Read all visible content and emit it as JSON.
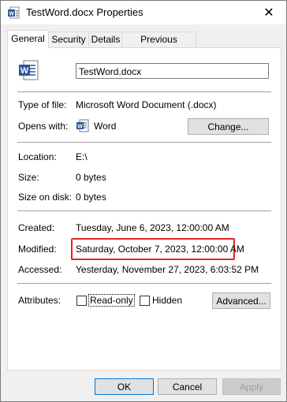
{
  "window": {
    "title": "TestWord.docx Properties",
    "close_symbol": "✕"
  },
  "tabs": [
    {
      "label": "General",
      "active": true
    },
    {
      "label": "Security",
      "active": false
    },
    {
      "label": "Details",
      "active": false
    },
    {
      "label": "Previous Versions",
      "active": false
    }
  ],
  "file": {
    "name": "TestWord.docx"
  },
  "info": {
    "type_label": "Type of file:",
    "type_value": "Microsoft Word Document (.docx)",
    "opens_label": "Opens with:",
    "opens_value": "Word",
    "change_button": "Change...",
    "location_label": "Location:",
    "location_value": "E:\\",
    "size_label": "Size:",
    "size_value": "0 bytes",
    "size_disk_label": "Size on disk:",
    "size_disk_value": "0 bytes",
    "created_label": "Created:",
    "created_value": "Tuesday, June 6, 2023, 12:00:00 AM",
    "modified_label": "Modified:",
    "modified_value": "Saturday, October 7, 2023, 12:00:00 AM",
    "accessed_label": "Accessed:",
    "accessed_value": "Yesterday, November 27, 2023, 6:03:52 PM",
    "attributes_label": "Attributes:",
    "readonly_label": "Read-only",
    "readonly_checked": false,
    "hidden_label": "Hidden",
    "hidden_checked": false,
    "advanced_button": "Advanced..."
  },
  "footer": {
    "ok": "OK",
    "cancel": "Cancel",
    "apply": "Apply"
  },
  "colors": {
    "word_blue": "#2b579a",
    "highlight_red": "#e62424",
    "default_button_border": "#0078d7"
  }
}
